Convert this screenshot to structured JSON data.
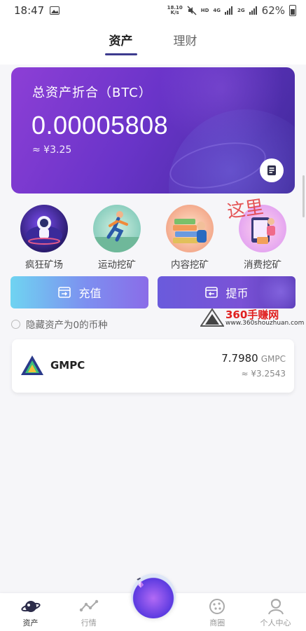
{
  "status_bar": {
    "time": "18:47",
    "net_speed_value": "18.10",
    "net_speed_unit": "K/s",
    "hd": "HD",
    "signal1": "4G",
    "signal2": "2G",
    "battery": "62%"
  },
  "top_tabs": [
    {
      "label": "资产",
      "active": true
    },
    {
      "label": "理财",
      "active": false
    }
  ],
  "asset_card": {
    "label": "总资产折合（BTC）",
    "amount": "0.00005808",
    "fiat": "≈ ¥3.25"
  },
  "mining": [
    {
      "label": "疯狂矿场",
      "icon": "planet-astronaut-icon"
    },
    {
      "label": "运动挖矿",
      "icon": "runner-icon"
    },
    {
      "label": "内容挖矿",
      "icon": "books-icon"
    },
    {
      "label": "消费挖矿",
      "icon": "shopping-icon"
    }
  ],
  "actions": {
    "deposit": "充值",
    "withdraw": "提币"
  },
  "hide_zero": "隐藏资产为0的币种",
  "watermark": {
    "site": "360手赚网",
    "url": "www.360shouzhuan.com",
    "stamp": "这里"
  },
  "coins": [
    {
      "name": "GMPC",
      "quantity": "7.7980",
      "unit": "GMPC",
      "fiat": "≈ ¥3.2543"
    }
  ],
  "bottom_nav": [
    {
      "label": "资产",
      "active": true
    },
    {
      "label": "行情",
      "active": false
    },
    {
      "label": "",
      "active": false
    },
    {
      "label": "商圈",
      "active": false
    },
    {
      "label": "个人中心",
      "active": false
    }
  ]
}
